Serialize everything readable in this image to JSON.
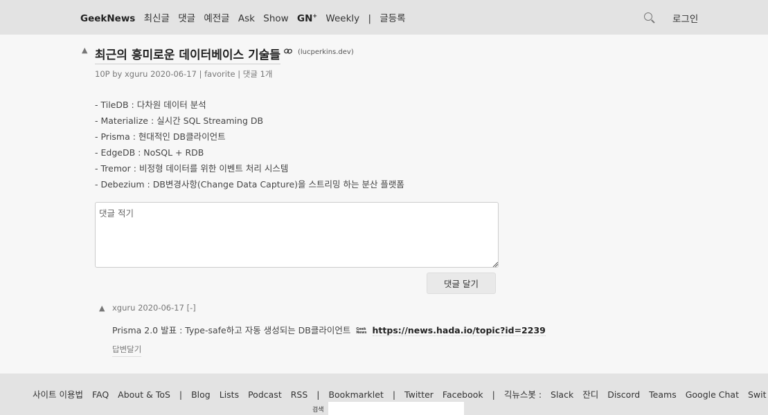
{
  "header": {
    "brand": "GeekNews",
    "nav": [
      "최신글",
      "댓글",
      "예전글",
      "Ask",
      "Show"
    ],
    "gn_label": "GN",
    "gn_sup": "+",
    "weekly": "Weekly",
    "separator": "|",
    "submit": "글등록",
    "login": "로그인",
    "search_icon": "search-icon"
  },
  "topic": {
    "upvote": "▲",
    "title": "최근의 흥미로운 데이터베이스 기술들",
    "domain": "(lucperkins.dev)",
    "points": "10P",
    "by": "by",
    "author": "xguru",
    "date": "2020-06-17",
    "meta_sep": "|",
    "favorite": "favorite",
    "comments": "댓글 1개",
    "lines": [
      "- TileDB : 다차원 데이터 분석",
      "- Materialize : 실시간 SQL Streaming DB",
      "- Prisma : 현대적인 DB클라이언트",
      "- EdgeDB : NoSQL + RDB",
      "- Tremor : 비정형 데이터를 위한 이벤트 처리 시스템",
      "- Debezium : DB변경사항(Change Data Capture)을 스트리밍 하는 분산 플랫폼"
    ]
  },
  "comment_form": {
    "placeholder": "댓글 적기",
    "value": "",
    "submit": "댓글 달기"
  },
  "comment": {
    "upvote": "▲",
    "author": "xguru",
    "date": "2020-06-17",
    "toggle": "[-]",
    "text": "Prisma 2.0 발표 : Type-safe하고 자동 생성되는 DB클라이언트",
    "logo_line1": "Geek",
    "logo_line2": "News",
    "link": "https://news.hada.io/topic?id=2239",
    "reply": "답변달기"
  },
  "footer": {
    "links": [
      "사이트 이용법",
      "FAQ",
      "About & ToS"
    ],
    "sep": "|",
    "links2": [
      "Blog",
      "Lists",
      "Podcast",
      "RSS"
    ],
    "bookmarklet": "Bookmarklet",
    "social": [
      "Twitter",
      "Facebook"
    ],
    "bots_label": "긱뉴스봇 :",
    "bots": [
      "Slack",
      "잔디",
      "Discord",
      "Teams",
      "Google Chat",
      "Swit"
    ],
    "search_label": "검색",
    "search_value": ""
  }
}
